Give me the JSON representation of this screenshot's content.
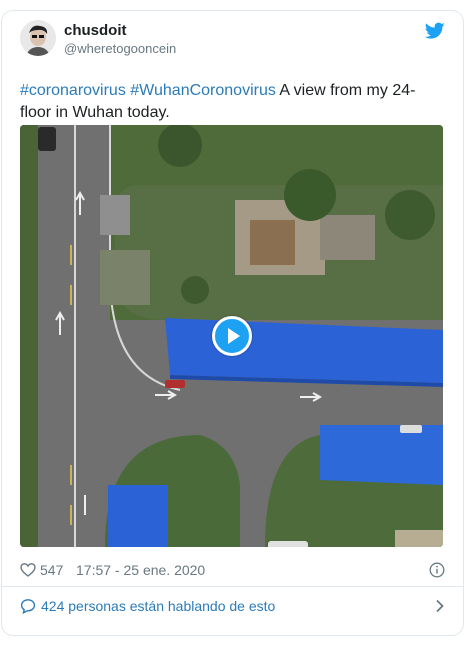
{
  "tweet": {
    "display_name": "chusdoit",
    "handle": "@wheretogooncein",
    "hashtag_1": "#coronarovirus",
    "hashtag_2": "#WuhanCoronovirus",
    "text_line": " A view from my 24-floor in Wuhan today.",
    "likes": "547",
    "timestamp": "17:57 - 25 ene. 2020",
    "discussion": "424 personas están hablando de esto"
  },
  "icons": {
    "logo": "twitter-bird-icon",
    "like": "heart-icon",
    "info": "info-icon",
    "reply": "reply-bubble-icon",
    "play": "play-icon",
    "chevron": "chevron-right-icon"
  },
  "colors": {
    "link": "#2b7bb9",
    "twitter_blue": "#1da1f2",
    "meta_gray": "#697882",
    "border": "#e1e8ed"
  }
}
